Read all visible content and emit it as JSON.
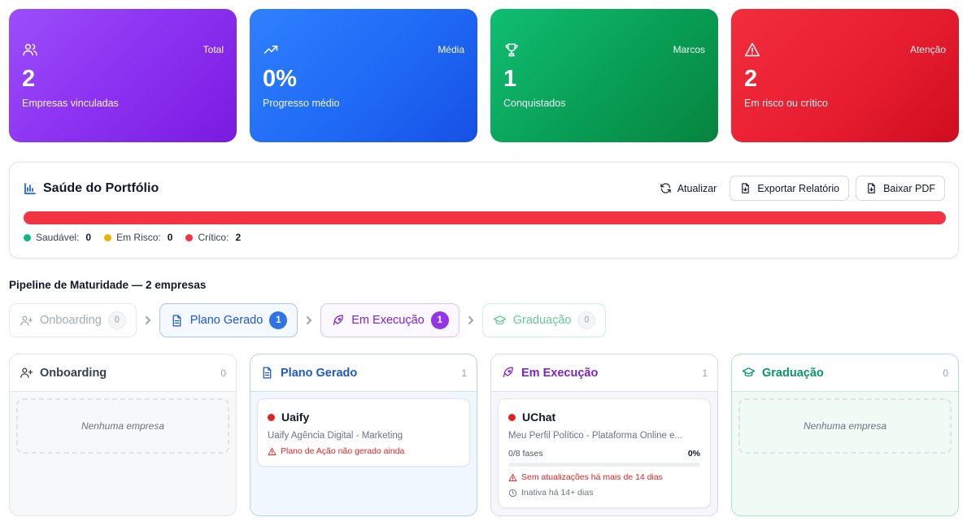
{
  "stats": [
    {
      "tag": "Total",
      "value": "2",
      "label": "Empresas vinculadas",
      "icon": "users-icon"
    },
    {
      "tag": "Média",
      "value": "0%",
      "label": "Progresso médio",
      "icon": "trending-up-icon"
    },
    {
      "tag": "Marcos",
      "value": "1",
      "label": "Conquistados",
      "icon": "trophy-icon"
    },
    {
      "tag": "Atenção",
      "value": "2",
      "label": "Em risco ou crítico",
      "icon": "alert-triangle-icon"
    }
  ],
  "health": {
    "title": "Saúde do Portfólio",
    "refresh_label": "Atualizar",
    "export_label": "Exportar Relatório",
    "pdf_label": "Baixar PDF",
    "distribution": {
      "healthy": 0,
      "at_risk": 0,
      "critical": 2
    },
    "colors": {
      "healthy": "#10b981",
      "at_risk": "#eab308",
      "critical": "#f43342"
    },
    "legend": [
      {
        "label": "Saudável:",
        "count": "0"
      },
      {
        "label": "Em Risco:",
        "count": "0"
      },
      {
        "label": "Crítico:",
        "count": "2"
      }
    ]
  },
  "pipeline": {
    "title": "Pipeline de Maturidade — 2 empresas",
    "steps": [
      {
        "label": "Onboarding",
        "count": "0",
        "icon": "user-plus-icon"
      },
      {
        "label": "Plano Gerado",
        "count": "1",
        "icon": "file-text-icon"
      },
      {
        "label": "Em Execução",
        "count": "1",
        "icon": "rocket-icon"
      },
      {
        "label": "Graduação",
        "count": "0",
        "icon": "graduation-cap-icon"
      }
    ],
    "columns": [
      {
        "title": "Onboarding",
        "count": "0",
        "empty_text": "Nenhuma empresa"
      },
      {
        "title": "Plano Gerado",
        "count": "1",
        "card": {
          "name": "Uaify",
          "desc": "Uaify Agência Digital - Marketing",
          "warning": "Plano de Ação não gerado ainda"
        }
      },
      {
        "title": "Em Execução",
        "count": "1",
        "card": {
          "name": "UChat",
          "desc": "Meu Perfil Político - Plataforma Online e...",
          "phases": "0/8 fases",
          "percent": "0%",
          "progress": 0,
          "warning": "Sem atualizações há mais de 14 dias",
          "inactive": "Inativa há 14+ dias"
        }
      },
      {
        "title": "Graduação",
        "count": "0",
        "empty_text": "Nenhuma empresa"
      }
    ]
  }
}
